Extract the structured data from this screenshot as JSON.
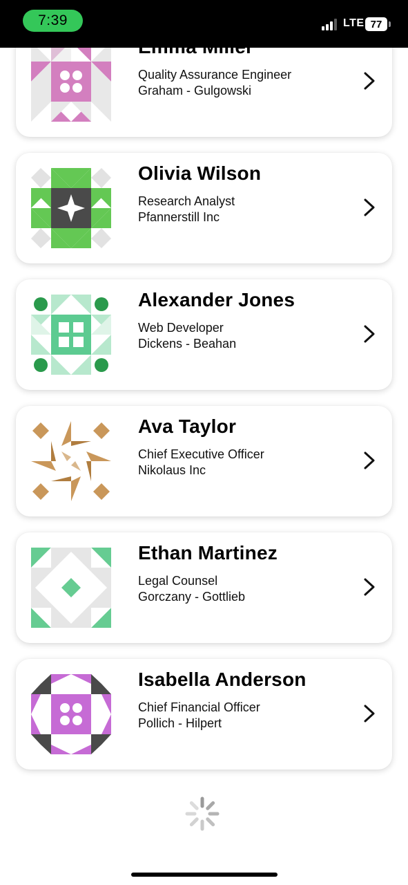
{
  "status_bar": {
    "time": "7:39",
    "network": "LTE",
    "battery": "77"
  },
  "contacts": [
    {
      "name": "Emma Miller",
      "title": "Quality Assurance Engineer",
      "company": "Graham - Gulgowski",
      "avatar_color": "#d37fbf"
    },
    {
      "name": "Olivia Wilson",
      "title": "Research Analyst",
      "company": "Pfannerstill Inc",
      "avatar_color": "#64c854"
    },
    {
      "name": "Alexander Jones",
      "title": "Web Developer",
      "company": "Dickens - Beahan",
      "avatar_color": "#5ccb91"
    },
    {
      "name": "Ava Taylor",
      "title": "Chief Executive Officer",
      "company": "Nikolaus Inc",
      "avatar_color": "#c9975a"
    },
    {
      "name": "Ethan Martinez",
      "title": "Legal Counsel",
      "company": "Gorczany - Gottlieb",
      "avatar_color": "#66cc92"
    },
    {
      "name": "Isabella Anderson",
      "title": "Chief Financial Officer",
      "company": "Pollich - Hilpert",
      "avatar_color": "#c66bd5"
    }
  ],
  "icons": {
    "row_action": "chevron-right-icon",
    "loading": "spinner-icon"
  }
}
